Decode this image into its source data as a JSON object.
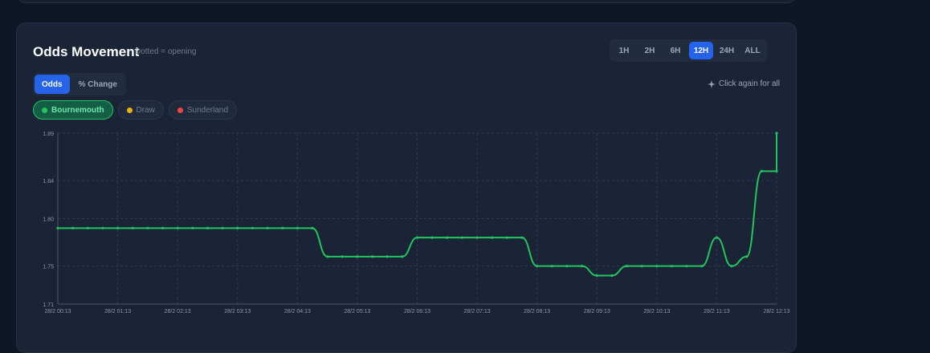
{
  "header": {
    "title": "Odds Movement",
    "subtitle": "Dotted = opening"
  },
  "ranges": [
    {
      "label": "1H",
      "active": false
    },
    {
      "label": "2H",
      "active": false
    },
    {
      "label": "6H",
      "active": false
    },
    {
      "label": "12H",
      "active": true
    },
    {
      "label": "24H",
      "active": false
    },
    {
      "label": "ALL",
      "active": false
    }
  ],
  "modes": [
    {
      "label": "Odds",
      "active": true
    },
    {
      "label": "% Change",
      "active": false
    }
  ],
  "hint": "Click again for all",
  "legend": [
    {
      "label": "Bournemouth",
      "color": "#22c55e",
      "active": true
    },
    {
      "label": "Draw",
      "color": "#eab308",
      "active": false
    },
    {
      "label": "Sunderland",
      "color": "#ef4444",
      "active": false
    }
  ],
  "chart_data": {
    "type": "line",
    "x_ticks": [
      "28/2 00:13",
      "28/2 01:13",
      "28/2 02:13",
      "28/2 03:13",
      "28/2 04:13",
      "28/2 05:13",
      "28/2 06:13",
      "28/2 07:13",
      "28/2 08:13",
      "28/2 09:13",
      "28/2 10:13",
      "28/2 11:13",
      "28/2 12:13"
    ],
    "y_ticks": [
      1.71,
      1.75,
      1.8,
      1.84,
      1.89
    ],
    "ylim": [
      1.71,
      1.89
    ],
    "grid": true,
    "series": [
      {
        "name": "Bournemouth",
        "color": "#22c55e",
        "x": [
          0,
          0.25,
          0.5,
          0.75,
          1,
          1.25,
          1.5,
          1.75,
          2,
          2.25,
          2.5,
          2.75,
          3,
          3.25,
          3.5,
          3.75,
          4,
          4.25,
          4.5,
          4.75,
          5,
          5.25,
          5.5,
          5.75,
          6,
          6.25,
          6.5,
          6.75,
          7,
          7.25,
          7.5,
          7.75,
          8,
          8.25,
          8.5,
          8.75,
          9,
          9.25,
          9.5,
          9.75,
          10,
          10.25,
          10.5,
          10.75,
          11,
          11.25,
          11.5,
          11.75,
          12,
          12
        ],
        "y": [
          1.79,
          1.79,
          1.79,
          1.79,
          1.79,
          1.79,
          1.79,
          1.79,
          1.79,
          1.79,
          1.79,
          1.79,
          1.79,
          1.79,
          1.79,
          1.79,
          1.79,
          1.79,
          1.76,
          1.76,
          1.76,
          1.76,
          1.76,
          1.76,
          1.78,
          1.78,
          1.78,
          1.78,
          1.78,
          1.78,
          1.78,
          1.78,
          1.75,
          1.75,
          1.75,
          1.75,
          1.74,
          1.74,
          1.75,
          1.75,
          1.75,
          1.75,
          1.75,
          1.75,
          1.78,
          1.75,
          1.76,
          1.85,
          1.85,
          1.89
        ]
      }
    ]
  }
}
